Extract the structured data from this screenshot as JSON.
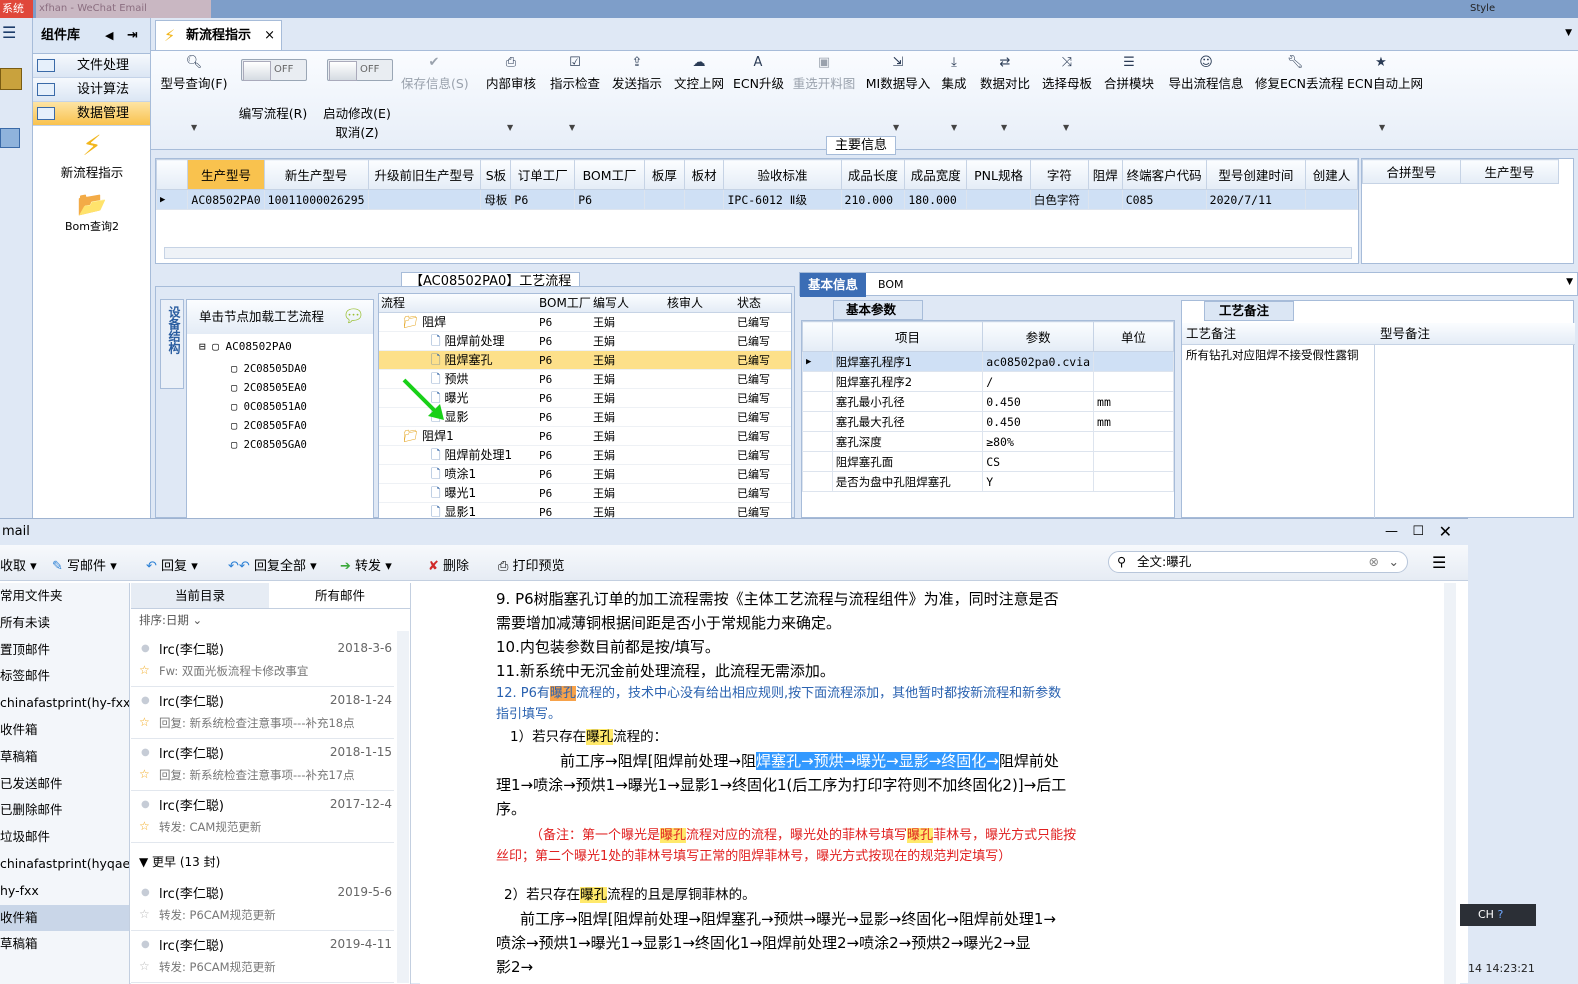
{
  "top": {
    "left_tab": "系统",
    "mid_tab": "xfhan - WeChat Email",
    "style": "Style"
  },
  "left_toolbar": {
    "icon": "menu-icon"
  },
  "component_nav": {
    "title": "组件库",
    "items": [
      {
        "label": "文件处理"
      },
      {
        "label": "设计算法"
      },
      {
        "label": "数据管理"
      }
    ],
    "big_items": [
      {
        "label": "新流程指示"
      },
      {
        "label": "Bom查询2"
      }
    ]
  },
  "doc_tab": {
    "title": "新流程指示",
    "close": "×"
  },
  "ribbon": {
    "buttons": [
      {
        "label": "型号查询(F)",
        "icon": "search-icon"
      },
      {
        "label": "编写流程(R)",
        "toggle": "OFF"
      },
      {
        "label": "启动修改(E)",
        "sub": "取消(Z)",
        "toggle": "OFF"
      },
      {
        "label": "保存信息(S)",
        "icon": "check-icon",
        "disabled": true
      },
      {
        "label": "内部审核",
        "icon": "print-icon"
      },
      {
        "label": "指示检查",
        "icon": "checkbox-icon"
      },
      {
        "label": "发送指示",
        "icon": "upload-icon"
      },
      {
        "label": "文控上网",
        "icon": "cloud-upload-icon"
      },
      {
        "label": "ECN升级",
        "icon": "font-icon"
      },
      {
        "label": "重选开料图",
        "icon": "image-icon",
        "disabled": true
      },
      {
        "label": "MI数据导入",
        "icon": "import-icon"
      },
      {
        "label": "集成",
        "icon": "download-icon"
      },
      {
        "label": "数据对比",
        "icon": "compare-icon"
      },
      {
        "label": "选择母板",
        "icon": "shuffle-icon"
      },
      {
        "label": "合拼模块",
        "icon": "list-icon"
      },
      {
        "label": "导出流程信息",
        "icon": "smile-icon"
      },
      {
        "label": "修复ECN丢流程",
        "icon": "wrench-icon"
      },
      {
        "label": "ECN自动上网",
        "icon": "star-icon"
      }
    ]
  },
  "main_info": {
    "title": "主要信息",
    "columns": [
      "生产型号",
      "新生产型号",
      "升级前旧生产型号",
      "S板",
      "订单工厂",
      "BOM工厂",
      "板厚",
      "板材",
      "验收标准",
      "成品长度",
      "成品宽度",
      "PNL规格",
      "字符",
      "阻焊",
      "终端客户代码",
      "型号创建时间",
      "创建人"
    ],
    "row": [
      "AC08502PA0",
      "10011000026295",
      "",
      "母板",
      "P6",
      "P6",
      "",
      "",
      "IPC-6012 Ⅱ级",
      "210.000",
      "180.000",
      "",
      "白色字符",
      "",
      "C085",
      "2020/7/11",
      ""
    ],
    "right_columns": [
      "合拼型号",
      "生产型号"
    ]
  },
  "process": {
    "title": "【AC08502PA0】工艺流程",
    "side_label": "设备结构",
    "hint": "单击节点加载工艺流程",
    "tree_root": "AC08502PA0",
    "tree_children": [
      "2C08505DA0",
      "2C08505EA0",
      "0C085051A0",
      "2C08505FA0",
      "2C08505GA0"
    ],
    "columns": [
      "流程",
      "BOM工厂",
      "编写人",
      "核审人",
      "状态"
    ],
    "rows": [
      {
        "name": "阻焊",
        "lvl": 0,
        "folder": true,
        "f": "P6",
        "w": "王娟",
        "s": "已编写"
      },
      {
        "name": "阻焊前处理",
        "lvl": 1,
        "f": "P6",
        "w": "王娟",
        "s": "已编写"
      },
      {
        "name": "阻焊塞孔",
        "lvl": 1,
        "f": "P6",
        "w": "王娟",
        "s": "已编写",
        "sel": true
      },
      {
        "name": "预烘",
        "lvl": 1,
        "f": "P6",
        "w": "王娟",
        "s": "已编写"
      },
      {
        "name": "曝光",
        "lvl": 1,
        "f": "P6",
        "w": "王娟",
        "s": "已编写"
      },
      {
        "name": "显影",
        "lvl": 1,
        "f": "P6",
        "w": "王娟",
        "s": "已编写"
      },
      {
        "name": "阻焊1",
        "lvl": 0,
        "folder": true,
        "f": "P6",
        "w": "王娟",
        "s": "已编写"
      },
      {
        "name": "阻焊前处理1",
        "lvl": 1,
        "f": "P6",
        "w": "王娟",
        "s": "已编写"
      },
      {
        "name": "喷涂1",
        "lvl": 1,
        "f": "P6",
        "w": "王娟",
        "s": "已编写"
      },
      {
        "name": "曝光1",
        "lvl": 1,
        "f": "P6",
        "w": "王娟",
        "s": "已编写"
      },
      {
        "name": "显影1",
        "lvl": 1,
        "f": "P6",
        "w": "王娟",
        "s": "已编写"
      }
    ]
  },
  "basic": {
    "tabs": [
      "基本信息",
      "BOM"
    ],
    "sub_tab": "基本参数",
    "columns": [
      "项目",
      "参数",
      "单位"
    ],
    "rows": [
      {
        "item": "阻焊塞孔程序1",
        "val": "ac08502pa0.cvia",
        "unit": ""
      },
      {
        "item": "阻焊塞孔程序2",
        "val": "/",
        "unit": ""
      },
      {
        "item": "塞孔最小孔径",
        "val": "0.450",
        "unit": "mm"
      },
      {
        "item": "塞孔最大孔径",
        "val": "0.450",
        "unit": "mm"
      },
      {
        "item": "塞孔深度",
        "val": "≥80%",
        "unit": ""
      },
      {
        "item": "阻焊塞孔面",
        "val": "CS",
        "unit": ""
      },
      {
        "item": "是否为盘中孔阻焊塞孔",
        "val": "Y",
        "unit": ""
      }
    ]
  },
  "craft": {
    "tab": "工艺备注",
    "col1": "工艺备注",
    "col2": "型号备注",
    "note": "所有钻孔对应阻焊不接受假性露铜"
  },
  "mail": {
    "title": "mail",
    "toolbar": [
      "收取",
      "写邮件",
      "回复",
      "回复全部",
      "转发",
      "删除",
      "打印预览"
    ],
    "search": "全文:曝孔",
    "folders": [
      "常用文件夹",
      "所有未读",
      "置顶邮件",
      "标签邮件",
      "chinafastprint(hy-fxx)",
      "收件箱",
      "草稿箱",
      "已发送邮件",
      "已删除邮件",
      "垃圾邮件",
      "chinafastprint(hyqae)",
      "hy-fxx",
      "收件箱",
      "草稿箱"
    ],
    "list_tabs": [
      "当前目录",
      "所有邮件"
    ],
    "sort": "排序:日期",
    "group": "更早 (13 封)",
    "items": [
      {
        "from": "lrc(李仁聪)",
        "date": "2018-3-6",
        "subject": "Fw: 双面光板流程卡修改事宜"
      },
      {
        "from": "lrc(李仁聪)",
        "date": "2018-1-24",
        "subject": "回复: 新系统检查注意事项---补充18点"
      },
      {
        "from": "lrc(李仁聪)",
        "date": "2018-1-15",
        "subject": "回复: 新系统检查注意事项---补充17点"
      },
      {
        "from": "lrc(李仁聪)",
        "date": "2017-12-4",
        "subject": "转发: CAM规范更新"
      },
      {
        "from": "lrc(李仁聪)",
        "date": "2019-5-6",
        "subject": "转发: P6CAM规范更新"
      },
      {
        "from": "lrc(李仁聪)",
        "date": "2019-4-11",
        "subject": "转发: P6CAM规范更新"
      }
    ],
    "body": {
      "p9a": "9.  P6树脂塞孔订单的加工流程需按《主体工艺流程与流程组件》为准，同时注意是否",
      "p9b": "需要增加减薄铜根据间距是否小于常规能力来确定。",
      "p10": "10.内包装参数目前都是按/填写。",
      "p11": "11.新系统中无沉金前处理流程，此流程无需添加。",
      "p12a": "12. P6有",
      "p12hl": "曝孔",
      "p12b": "流程的，技术中心没有给出相应规则,按下面流程添加，其他暂时都按新流程和新参数",
      "p12c": "指引填写。",
      "s1a": "1）若只存在",
      "s1hl": "曝孔",
      "s1b": "流程的：",
      "f1a": "前工序→阻焊[阻焊前处理→阻",
      "f1sel": "焊塞孔→预烘→曝光→显影→终固化→",
      "f1b": "阻焊前处",
      "f1c": "理1→喷涂→预烘1→曝光1→显影1→终固化1(后工序为打印字符则不加终固化2)]→后工",
      "f1d": "序。",
      "n1a": "（备注：第一个曝光是",
      "n1hl": "曝孔",
      "n1b": "流程对应的流程，曝光处的菲林号填写",
      "n1hl2": "曝孔",
      "n1c": "菲林号，曝光方式只能按",
      "n1d": "丝印；第二个曝光1处的菲林号填写正常的阻焊菲林号，曝光方式按现在的规范判定填写）",
      "s2a": "2）若只存在",
      "s2hl": "曝孔",
      "s2b": "流程的且是厚铜菲林的。",
      "f2a": "前工序→阻焊[阻焊前处理→阻焊塞孔→预烘→曝光→显影→终固化→阻焊前处理1→",
      "f2b": "喷涂→预烘1→曝光1→显影1→终固化1→阻焊前处理2→喷涂2→预烘2→曝光2→显",
      "f2c": "影2→"
    }
  },
  "ime": {
    "label": "CH",
    "time": "14 14:23:21"
  }
}
